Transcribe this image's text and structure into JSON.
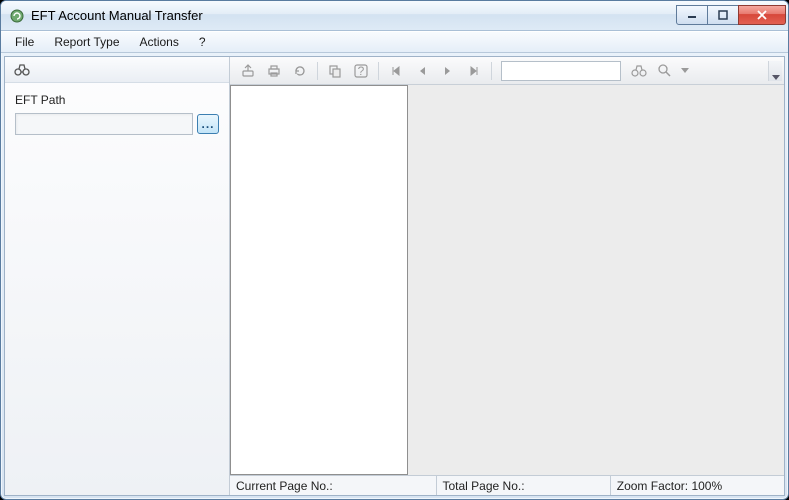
{
  "window": {
    "title": "EFT Account Manual Transfer"
  },
  "menubar": {
    "file": "File",
    "report_type": "Report Type",
    "actions": "Actions",
    "help": "?"
  },
  "left_panel": {
    "eft_path_label": "EFT Path",
    "eft_path_value": "",
    "browse_label": "..."
  },
  "toolbar": {
    "search_value": ""
  },
  "statusbar": {
    "current_page_label": "Current Page No.:",
    "current_page_value": "",
    "total_page_label": "Total Page No.:",
    "total_page_value": "",
    "zoom_label": "Zoom Factor:",
    "zoom_value": "100%"
  }
}
